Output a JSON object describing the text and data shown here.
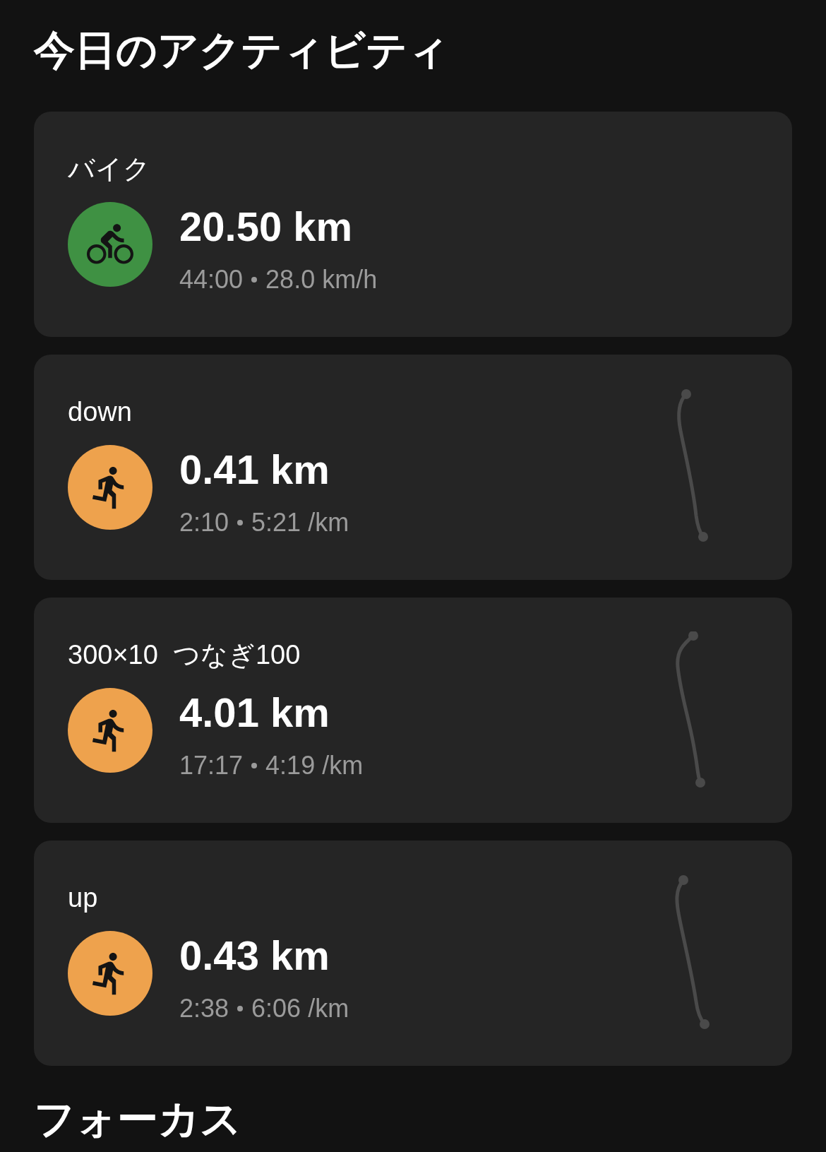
{
  "title": "今日のアクティビティ",
  "activities": [
    {
      "name": "バイク",
      "kind": "bike",
      "distance": "20.50 km",
      "duration": "44:00",
      "rate": "28.0 km/h",
      "route": false
    },
    {
      "name": "down",
      "kind": "run",
      "distance": "0.41 km",
      "duration": "2:10",
      "rate": "5:21 /km",
      "route": true
    },
    {
      "name": "300×10  つなぎ100",
      "kind": "run",
      "distance": "4.01 km",
      "duration": "17:17",
      "rate": "4:19 /km",
      "route": true
    },
    {
      "name": "up",
      "kind": "run",
      "distance": "0.43 km",
      "duration": "2:38",
      "rate": "6:06 /km",
      "route": true
    }
  ],
  "next_section": "フォーカス"
}
